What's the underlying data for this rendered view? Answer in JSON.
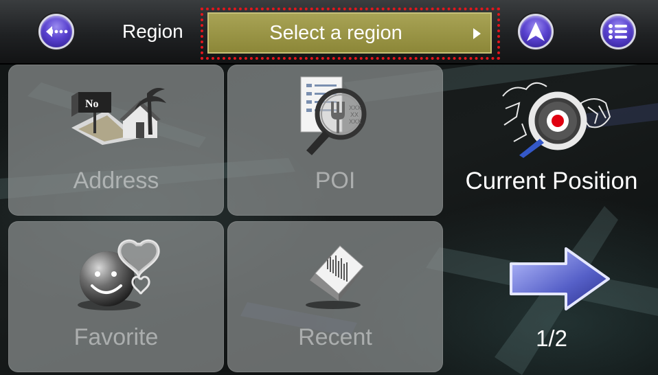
{
  "header": {
    "back_icon": "back-icon",
    "region_label": "Region",
    "region_value": "Select a region",
    "navigate_icon": "navigation-arrow-icon",
    "menu_icon": "list-menu-icon"
  },
  "tiles": {
    "address": {
      "label": "Address",
      "icon": "address-house-icon"
    },
    "poi": {
      "label": "POI",
      "icon": "poi-magnifier-icon"
    },
    "favorite": {
      "label": "Favorite",
      "icon": "favorite-smiley-heart-icon"
    },
    "recent": {
      "label": "Recent",
      "icon": "recent-document-icon"
    }
  },
  "side": {
    "current_position": {
      "label": "Current Position",
      "icon": "current-position-map-icon"
    },
    "next_page": {
      "page_indicator": "1/2",
      "icon": "next-page-arrow-icon"
    }
  },
  "colors": {
    "button_purple": "#5a43d0",
    "region_olive": "#a8a355",
    "focus_red": "#e3161c"
  }
}
